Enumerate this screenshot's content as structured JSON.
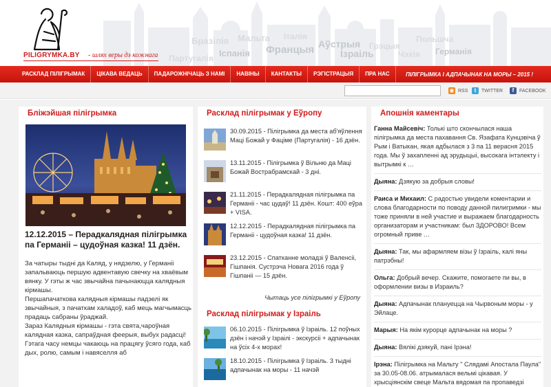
{
  "header": {
    "logo_text": "PILIGRYMKA.BY",
    "slogan": "- шлях веры дэ кожнага",
    "countries": [
      "Бразілія",
      "Мальта",
      "Італія",
      "Аўстрыя",
      "Грэцыя",
      "Польшча",
      "Партугалія",
      "Іспанія",
      "Францыя",
      "Ізраіль",
      "Чэхія",
      "Германія"
    ]
  },
  "nav": {
    "items": [
      "РАСКЛАД ПІЛІГРЫМАК",
      "ЦІКАВА ВЕДАЦЬ",
      "ПАДАРОЖНІЧАЦЬ З НАМІ",
      "НАВІНЫ",
      "КАНТАКТЫ",
      "РЭГІСТРАЦЫЯ",
      "ПРА НАС"
    ],
    "promo": "ПІЛІГРЫМКА І АДПАЧЫНАК НА МОРЫ – 2015 !"
  },
  "toolbar": {
    "search_value": "",
    "rss": "RSS",
    "twitter": "TWITTER",
    "facebook": "FACEBOOK"
  },
  "left": {
    "title": "Бліжэйшая пілігрымка",
    "headline": "12.12.2015 – Перадкалядная пілігрымка па Германіі – цудоўная казка! 11 дзён.",
    "paragraphs": [
      "За чатыры тыдні да Каляд, у нядзелю, у Германіі запальваюць першую адвентавую свечку на хваёвым вянку. У гэты ж час звычайна пачынаюцца калядныя кірмашы.",
      "Першапачаткова калядныя кірмашы падзелі як звычайныя, з пачаткам халадоў, каб мець магчымасць прадаць сабраны ўраджай.",
      "Зараз Калядныя кірмашы - гэта свята,чароўная калядная казка, сапраўдная феерыя, выбух радасці! Гэтага часу немцы чакаюць на працягу ўсяго года, каб дых, ролю, самым і навяселля аб"
    ]
  },
  "middle": {
    "title_europe": "Расклад пілігрымак у Еўропу",
    "europe": [
      "30.09.2015 - Пілігрымка да места аб'яўлення Маці Божай у Фаціме (Партугалія) - 16 дзён.",
      "13.11.2015 - Пілігрымка ў Вільню да Маці Божай Вострабрамскай - 3 дні.",
      "21.11.2015 - Перадкалядная пілігрымка па Германіі - час цудаў! 11 дзён. Кошт: 400 еўра + VISA.",
      "12.12.2015 - Перадкалядная пілігрымка па Германіі - цудоўная казка! 11 дзён.",
      "23.12.2015 - Спатканне моладзі ў Валенсіі, Гішпанія. Сустрэча Новага 2016 года ў Гішпаніі — 15 дзён."
    ],
    "all_europe": "Чытаць усе пілігрымкі у Еўропу",
    "title_israel": "Расклад пілігрымак у Ізраіль",
    "israel": [
      "06.10.2015 - Пілігрымка ў Ізраіль. 12 поўных дзён і начэй у Ізраілі - экскурсіі + адпачынак на ўсіх 4-х морах!",
      "18.10.2015 - Пілігрымка ў Ізраіль. 3 тыдні адпачынак на моры - 11 начэй"
    ]
  },
  "right": {
    "title": "Апошнія каментары",
    "comments": [
      {
        "author": "Ганна Майсевіч:",
        "text": "Толькі што скончылася наша пілігрымка да места пахавання Св. Язафата Кунцэвіча ў Рым і Ватыкан, якая адбылася з 3 па 11 верасня 2015 года. Мы ў захапленні ад эрудыцыі, высокага інтэлекту і вытрымкі к …"
      },
      {
        "author": "Дыяна:",
        "text": "Дзякую за добрыя словы!"
      },
      {
        "author": "Раиса и Михаил:",
        "text": "С радостью увидели коментарии и слова благодарности по поводу данной пилигримки - мы тоже приняли в ней участие и выражаем благодарность организаторам и участникам: был ЗДОРОВО! Всем огромный приве …"
      },
      {
        "author": "Дыяна:",
        "text": "Так, мы афармляем візы ў Ізраіль, калі яны патрэбны!"
      },
      {
        "author": "Ольга:",
        "text": "Добрый вечер. Скажите, помогаете пи вы, в оформлении визы в Израиль?"
      },
      {
        "author": "Дыяна:",
        "text": "Адпачынак плануецца на Чырвоным моры - у Эйлаце."
      },
      {
        "author": "Марыя:",
        "text": "На якім курорце адпачынак на моры ?"
      },
      {
        "author": "Дыяна:",
        "text": "Вялікі дзякуй, пані Ірэна!"
      },
      {
        "author": "Ірэна:",
        "text": "Пілігрымка на Мальту \" Слядамі Апостала Паула\" за 30.05-08.06. атрымалася вельмі цікавая. У хрысціянскім свеце Мальта вядомая па пропаведзі"
      }
    ]
  },
  "colors": {
    "brand_red": "#d01c1c",
    "nav_red": "#e02018",
    "background": "#f2f2f2"
  }
}
